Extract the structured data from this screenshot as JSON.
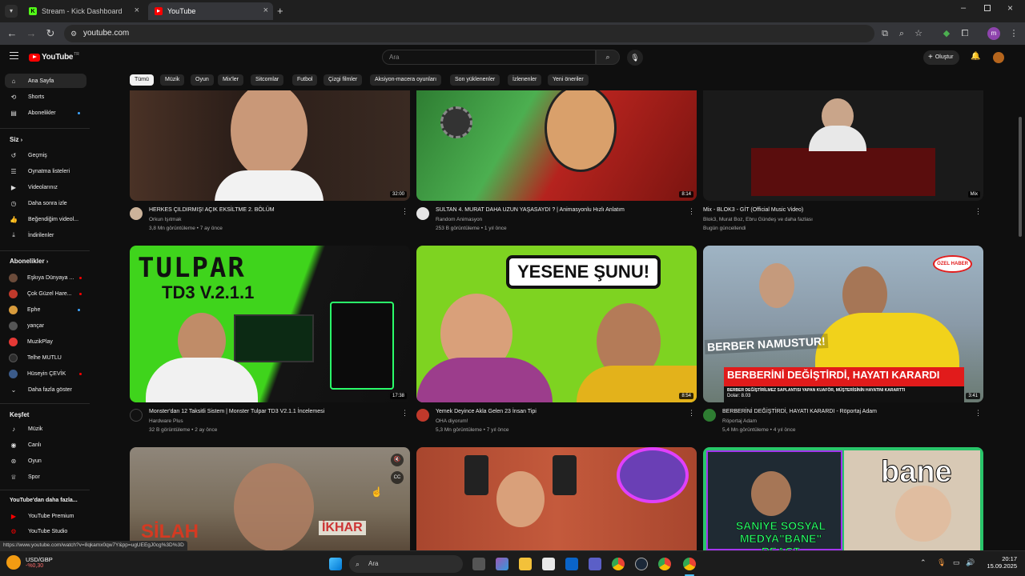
{
  "browser": {
    "tabs": [
      {
        "label": "Stream - Kick Dashboard",
        "active": false
      },
      {
        "label": "YouTube",
        "active": true
      }
    ],
    "url": "youtube.com",
    "profile_initial": "m"
  },
  "header": {
    "logo": "YouTube",
    "logo_region": "TR",
    "search_placeholder": "Ara",
    "create_label": "Oluştur"
  },
  "sidebar": {
    "main": [
      {
        "label": "Ana Sayfa",
        "icon": "home-icon",
        "selected": true
      },
      {
        "label": "Shorts",
        "icon": "shorts-icon"
      },
      {
        "label": "Abonelikler",
        "icon": "subscriptions-icon",
        "dot": true
      }
    ],
    "you_header": "Siz",
    "you": [
      {
        "label": "Geçmiş",
        "icon": "history-icon"
      },
      {
        "label": "Oynatma listeleri",
        "icon": "playlist-icon"
      },
      {
        "label": "Videolarınız",
        "icon": "your-videos-icon"
      },
      {
        "label": "Daha sonra izle",
        "icon": "watch-later-icon"
      },
      {
        "label": "Beğendiğim videol...",
        "icon": "like-icon"
      },
      {
        "label": "İndirilenler",
        "icon": "download-icon"
      }
    ],
    "subs_header": "Abonelikler",
    "subs": [
      {
        "label": "Eşkıya Dünyaya ...",
        "color": "#6b4b3a",
        "badge": "live"
      },
      {
        "label": "Çok Güzel Hare...",
        "color": "#c0392b",
        "badge": "live"
      },
      {
        "label": "Ephe",
        "color": "#d89b3c",
        "badge": "dot"
      },
      {
        "label": "yançar",
        "color": "#555555",
        "badge": ""
      },
      {
        "label": "MuzikPlay",
        "color": "#e53935",
        "badge": ""
      },
      {
        "label": "Telhe MUTLU",
        "color": "#2d2d2d",
        "badge": ""
      },
      {
        "label": "Hüseyin ÇEVİK",
        "color": "#3b5b8a",
        "badge": "live"
      },
      {
        "label": "Daha fazla göster",
        "color": "",
        "badge": ""
      }
    ],
    "explore_header": "Keşfet",
    "explore": [
      {
        "label": "Müzik",
        "icon": "music-icon"
      },
      {
        "label": "Canlı",
        "icon": "live-icon"
      },
      {
        "label": "Oyun",
        "icon": "gaming-icon"
      },
      {
        "label": "Spor",
        "icon": "sports-icon"
      }
    ],
    "more_header": "YouTube'dan daha fazla...",
    "more": [
      {
        "label": "YouTube Premium"
      },
      {
        "label": "YouTube Studio"
      }
    ]
  },
  "chips": [
    "Tümü",
    "Müzik",
    "Oyun",
    "Mix'ler",
    "Sitcomlar",
    "Futbol",
    "Çizgi filmler",
    "Aksiyon-macera oyunları",
    "Son yüklenenler",
    "İzlenenler",
    "Yeni öneriler"
  ],
  "videos": [
    {
      "title": "HERKES ÇILDIRMIŞ! AÇIK EKSİLTME 2. BÖLÜM",
      "channel": "Orkun Işıtmak",
      "meta": "3,8 Mn görüntüleme • 7 ay önce",
      "duration": "32:00",
      "bg": "#4a3226",
      "av": "#ccb39a",
      "verified": true
    },
    {
      "title": "SULTAN 4. MURAT DAHA UZUN YAŞASAYDI ? | Animasyonlu Hızlı Anlatım",
      "channel": "Random Animasyon",
      "meta": "253 B görüntüleme • 1 yıl önce",
      "duration": "8:14",
      "bg": "#b5231e",
      "av": "#e5e5e5",
      "verified": true
    },
    {
      "title": "Mix - BLOK3 - GİT (Official Music Video)",
      "channel": "Blok3, Murat Boz, Ebru Gündeş ve daha fazlası",
      "meta": "Bugün güncellendi",
      "duration": "Mix",
      "bg": "#1a1a1a",
      "av": "",
      "verified": false
    },
    {
      "title": "Monster'dan 12 Taksitli Sistem | Monster Tulpar TD3 V2.1.1 İncelemesi",
      "channel": "Hardware Plus",
      "meta": "32 B görüntüleme • 2 ay önce",
      "duration": "17:38",
      "bg": "#3fd41c",
      "av": "#111111",
      "verified": true
    },
    {
      "title": "Yemek Deyince Akla Gelen 23 İnsan Tipi",
      "channel": "OHA diyorum!",
      "meta": "5,3 Mn görüntüleme • 7 yıl önce",
      "duration": "8:54",
      "bg": "#7ed321",
      "av": "#c0392b",
      "verified": true
    },
    {
      "title": "BERBERİNİ DEĞİŞTİRDİ, HAYATI KARARDI - Röportaj Adam",
      "channel": "Röportaj Adam",
      "meta": "5,4 Mn görüntüleme • 4 yıl önce",
      "duration": "3:41",
      "bg": "#8a9aa8",
      "av": "#2e7d32",
      "verified": true
    },
    {
      "title": "",
      "channel": "",
      "meta": "",
      "duration": "",
      "bg": "#7a6e5c",
      "av": "",
      "verified": false
    },
    {
      "title": "",
      "channel": "",
      "meta": "",
      "duration": "",
      "bg": "#a8462e",
      "av": "",
      "verified": false
    },
    {
      "title": "",
      "channel": "",
      "meta": "",
      "duration": "",
      "bg": "#1f2a22",
      "av": "",
      "verified": false
    }
  ],
  "thumb_text": {
    "t1": "TULPAR",
    "t1b": "TD3 V.2.1.1",
    "t2": "YESENE ŞUNU!",
    "t3": "BERBER NAMUSTUR!",
    "t3b": "BERBERİNİ DEĞİŞTİRDİ, HAYATI KARARDI",
    "t3c": "BERBER DEĞİŞTİRİLMEZ SAPLANTISI YAPAN KUAFÖR, MÜŞTERİSİNİN HAYATINI KARARTTI",
    "t3d": "Dolar: 8.03",
    "t3e": "ÖZEL HABER",
    "t4": "bane",
    "t5": "SANİYE SOSYAL MEDYA\"BANE\" REACT",
    "t6": "SİLAH",
    "t6b": "İKHAR"
  },
  "status_url": "https://www.youtube.com/watch?v=8qkamx0qw7Y&pp=ugUEEgJ0cg%3D%3D",
  "taskbar": {
    "ticker": "USD/GBP",
    "ticker_change": "-%0,30",
    "search": "Ara",
    "time": "20:17",
    "date": "15.09.2025"
  }
}
